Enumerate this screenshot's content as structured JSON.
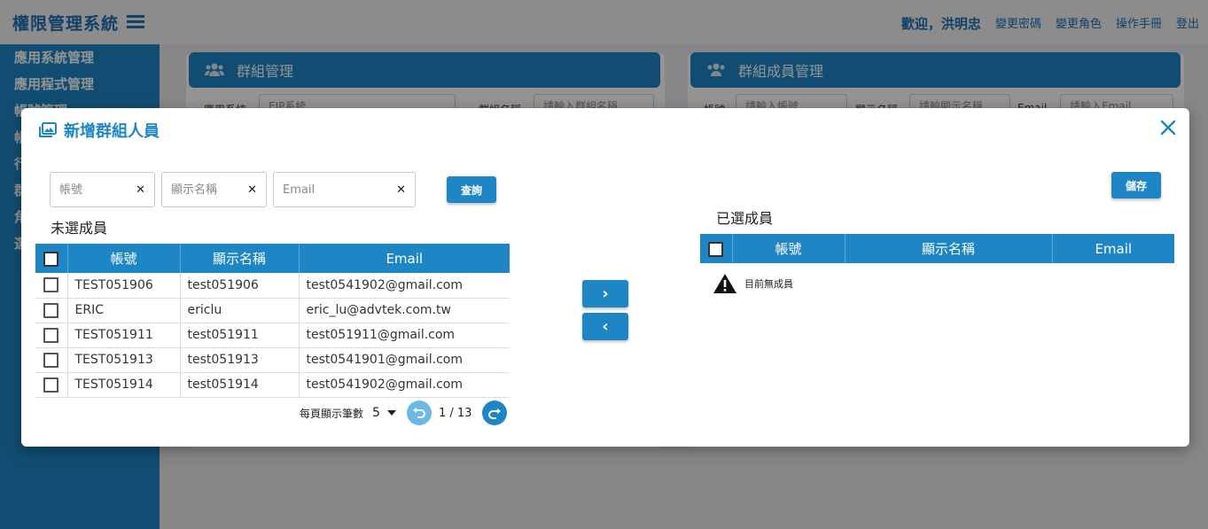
{
  "app": {
    "title": "權限管理系統",
    "welcome": "歡迎，洪明忠",
    "links": [
      "變更密碼",
      "變更角色",
      "操作手冊",
      "登出"
    ]
  },
  "sidebar": {
    "items": [
      "應用系統管理",
      "應用程式管理",
      "帳號管理",
      "帳",
      "行",
      "群",
      "角",
      "選"
    ]
  },
  "background": {
    "left_panel_title": "群組管理",
    "right_panel_title": "群組成員管理",
    "app_label": "應用系統",
    "app_value": "EIP系統",
    "group_label": "群組名稱",
    "group_placeholder": "請輸入群組名稱",
    "account_label": "帳號",
    "account_placeholder": "請輸入帳號",
    "display_label": "顯示名稱",
    "display_placeholder": "請輸顯示名稱",
    "email_label": "Email",
    "email_placeholder": "請輸入Email"
  },
  "modal": {
    "title": "新增群組人員",
    "filters": {
      "account_placeholder": "帳號",
      "display_placeholder": "顯示名稱",
      "email_placeholder": "Email",
      "clear_symbol": "✕"
    },
    "query_button": "查詢",
    "save_button": "儲存",
    "unselected_title": "未選成員",
    "selected_title": "已選成員",
    "columns": [
      "帳號",
      "顯示名稱",
      "Email"
    ],
    "rows": [
      {
        "account": "TEST051906",
        "display": "test051906",
        "email": "test0541902@gmail.com"
      },
      {
        "account": "ERIC",
        "display": "ericlu",
        "email": "eric_lu@advtek.com.tw"
      },
      {
        "account": "TEST051911",
        "display": "test051911",
        "email": "test051911@gmail.com"
      },
      {
        "account": "TEST051913",
        "display": "test051913",
        "email": "test0541901@gmail.com"
      },
      {
        "account": "TEST051914",
        "display": "test051914",
        "email": "test0541902@gmail.com"
      }
    ],
    "pager": {
      "per_page_label": "每頁顯示筆數",
      "per_page_value": "5",
      "page_info": "1 / 13"
    },
    "move_right": "›",
    "move_left": "‹",
    "empty_text": "目前無成員"
  },
  "colors": {
    "primary": "#1e86c4",
    "title_blue": "#1e6fb4"
  }
}
